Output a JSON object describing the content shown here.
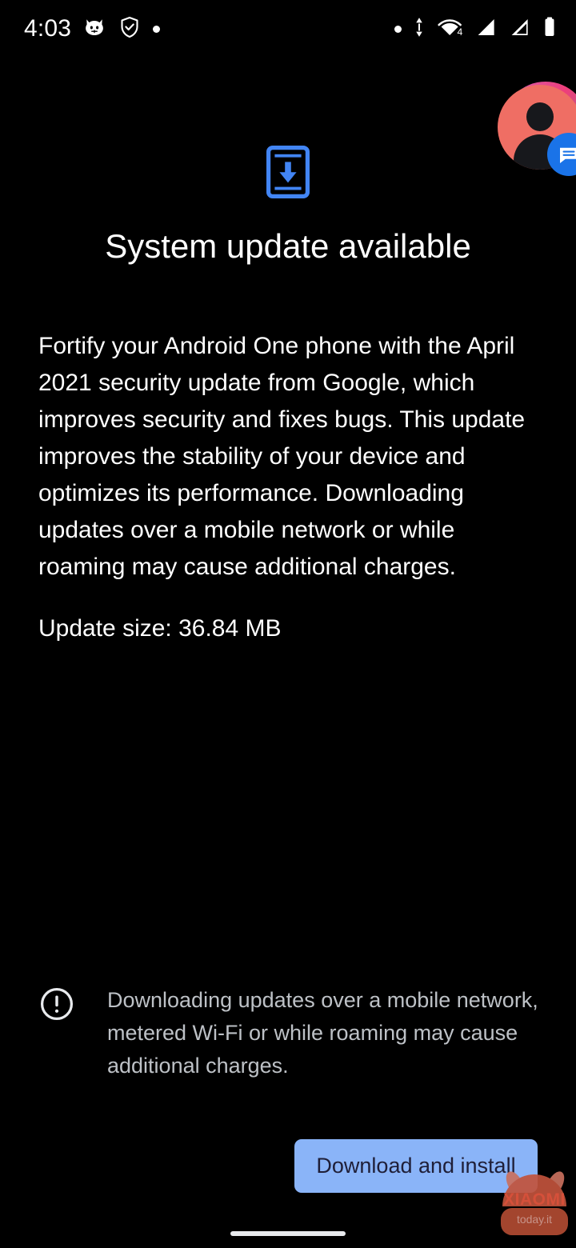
{
  "status_bar": {
    "time": "4:03",
    "left_icons": [
      {
        "name": "cat-face-icon",
        "label": "cat face notification"
      },
      {
        "name": "adguard-shield-icon",
        "label": "shield with checkmark"
      },
      {
        "name": "notification-dot-icon",
        "label": "dot"
      }
    ],
    "right_icons": [
      {
        "name": "notification-dot-icon",
        "label": "dot"
      },
      {
        "name": "data-transfer-icon",
        "label": "mobile data up down arrows"
      },
      {
        "name": "wifi-icon",
        "label": "wifi signal",
        "badge": "4"
      },
      {
        "name": "signal-sim1-icon",
        "label": "cellular signal sim 1"
      },
      {
        "name": "signal-sim2-icon",
        "label": "cellular signal sim 2"
      },
      {
        "name": "battery-icon",
        "label": "battery full"
      }
    ]
  },
  "chat_head": {
    "name": "messages-chat-head",
    "avatar_color": "#ef6e64",
    "badge_color": "#1a73e8",
    "badge_icon": "messages-icon"
  },
  "header": {
    "icon": "system-update-phone-icon",
    "icon_color": "#4285f4",
    "title": "System update available"
  },
  "main": {
    "description": "Fortify your Android One phone with the April 2021 security update from Google, which improves security and fixes bugs. This update improves the stability of your device and optimizes its performance. Downloading updates over a mobile network or while roaming may cause additional charges.",
    "update_size": "Update size: 36.84 MB"
  },
  "warning": {
    "icon": "exclamation-circle-icon",
    "text": "Downloading updates over a mobile network, metered Wi-Fi or while roaming may cause additional charges.",
    "text_color": "#bdc1c6"
  },
  "actions": {
    "download_label": "Download and install",
    "download_bg": "#8ab4f8",
    "download_fg": "#1f1f38"
  },
  "watermark": {
    "brand": "XIAOMI",
    "sub": "today.it",
    "color": "#e8573f"
  },
  "nav": {
    "gesture_pill": "home-gesture-pill"
  }
}
